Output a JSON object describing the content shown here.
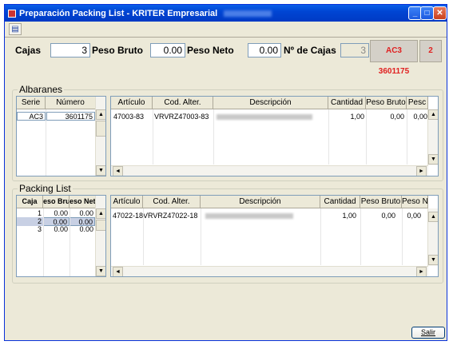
{
  "window": {
    "title": "Preparación Packing List - KRITER Empresarial"
  },
  "header": {
    "cajas_label": "Cajas",
    "cajas_value": "3",
    "peso_bruto_label": "Peso Bruto",
    "peso_bruto_value": "0.00",
    "peso_neto_label": "Peso Neto",
    "peso_neto_value": "0.00",
    "num_cajas_label": "Nº de Cajas",
    "num_cajas_value": "3",
    "documento": "AC3 3601175",
    "count": "2"
  },
  "albaranes": {
    "group_title": "Albaranes",
    "columns": [
      "Serie",
      "Número"
    ],
    "rows": [
      {
        "serie": "AC3",
        "numero": "3601175"
      }
    ]
  },
  "albaranes_lines": {
    "columns": [
      "Artículo",
      "Cod. Alter.",
      "Descripción",
      "Cantidad",
      "Peso Bruto",
      "Pesc"
    ],
    "rows": [
      {
        "articulo": "47003-83",
        "cod_alter": "VRVRZ47003-83",
        "cantidad": "1,00",
        "peso_bruto": "0,00",
        "peso_neto": "0,00"
      }
    ]
  },
  "packing": {
    "group_title": "Packing List",
    "columns": [
      "Caja",
      "eso Brut",
      "eso Net"
    ],
    "rows": [
      {
        "caja": "1",
        "bruto": "0.00",
        "neto": "0.00"
      },
      {
        "caja": "2",
        "bruto": "0.00",
        "neto": "0.00"
      },
      {
        "caja": "3",
        "bruto": "0.00",
        "neto": "0.00"
      }
    ]
  },
  "packing_lines": {
    "columns": [
      "Artículo",
      "Cod. Alter.",
      "Descripción",
      "Cantidad",
      "Peso Bruto",
      "Peso N"
    ],
    "rows": [
      {
        "articulo": "47022-18",
        "cod_alter": "VRVRZ47022-18",
        "cantidad": "1,00",
        "peso_bruto": "0,00",
        "peso_neto": "0,00"
      }
    ]
  },
  "footer": {
    "salir_label": "Salir"
  }
}
